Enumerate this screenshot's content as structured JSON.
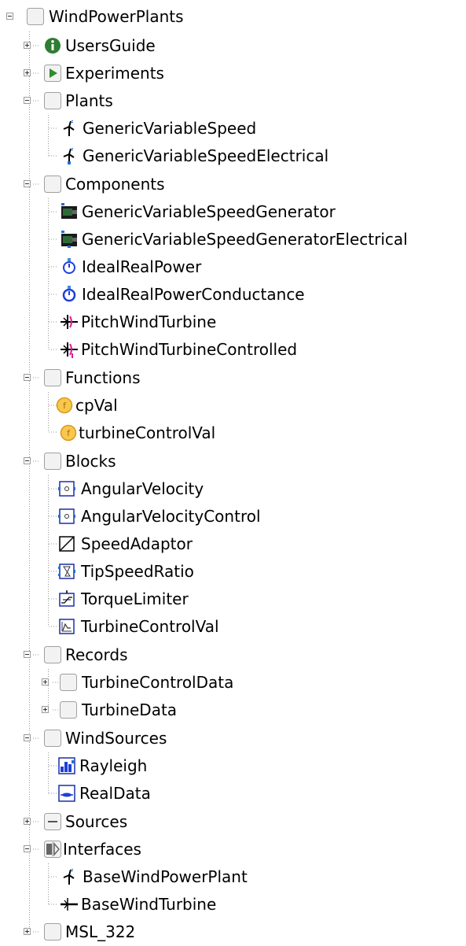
{
  "tree": {
    "root": {
      "label": "WindPowerPlants",
      "icon": "package-icon",
      "state": "expanded"
    },
    "users_guide": {
      "label": "UsersGuide",
      "icon": "info-icon",
      "state": "collapsed"
    },
    "experiments": {
      "label": "Experiments",
      "icon": "play-icon",
      "state": "collapsed"
    },
    "plants": {
      "label": "Plants",
      "icon": "package-icon",
      "state": "expanded",
      "items": [
        {
          "label": "GenericVariableSpeed",
          "icon": "wind-plant-icon"
        },
        {
          "label": "GenericVariableSpeedElectrical",
          "icon": "wind-plant-icon"
        }
      ]
    },
    "components": {
      "label": "Components",
      "icon": "package-icon",
      "state": "expanded",
      "items": [
        {
          "label": "GenericVariableSpeedGenerator",
          "icon": "generator-icon"
        },
        {
          "label": "GenericVariableSpeedGeneratorElectrical",
          "icon": "generator-icon"
        },
        {
          "label": "IdealRealPower",
          "icon": "power-meter-icon"
        },
        {
          "label": "IdealRealPowerConductance",
          "icon": "power-meter-icon"
        },
        {
          "label": "PitchWindTurbine",
          "icon": "wind-turbine-icon"
        },
        {
          "label": "PitchWindTurbineControlled",
          "icon": "wind-turbine-icon"
        }
      ]
    },
    "functions": {
      "label": "Functions",
      "icon": "package-icon",
      "state": "expanded",
      "items": [
        {
          "label": "cpVal",
          "icon": "function-icon"
        },
        {
          "label": "turbineControlVal",
          "icon": "function-icon"
        }
      ]
    },
    "blocks": {
      "label": "Blocks",
      "icon": "package-icon",
      "state": "expanded",
      "items": [
        {
          "label": "AngularVelocity",
          "icon": "block-circle-icon"
        },
        {
          "label": "AngularVelocityControl",
          "icon": "block-circle-icon"
        },
        {
          "label": "SpeedAdaptor",
          "icon": "block-diagonal-icon"
        },
        {
          "label": "TipSpeedRatio",
          "icon": "block-hourglass-icon"
        },
        {
          "label": "TorqueLimiter",
          "icon": "block-limiter-icon"
        },
        {
          "label": "TurbineControlVal",
          "icon": "block-graph-icon"
        }
      ]
    },
    "records": {
      "label": "Records",
      "icon": "package-icon",
      "state": "expanded",
      "items": [
        {
          "label": "TurbineControlData",
          "icon": "package-icon",
          "state": "collapsed"
        },
        {
          "label": "TurbineData",
          "icon": "package-icon",
          "state": "collapsed"
        }
      ]
    },
    "wind_sources": {
      "label": "WindSources",
      "icon": "package-icon",
      "state": "expanded",
      "items": [
        {
          "label": "Rayleigh",
          "icon": "rayleigh-source-icon"
        },
        {
          "label": "RealData",
          "icon": "real-data-source-icon"
        }
      ]
    },
    "sources": {
      "label": "Sources",
      "icon": "sources-package-icon",
      "state": "collapsed"
    },
    "interfaces": {
      "label": "Interfaces",
      "icon": "interfaces-package-icon",
      "state": "expanded",
      "items": [
        {
          "label": "BaseWindPowerPlant",
          "icon": "wind-plant-icon"
        },
        {
          "label": "BaseWindTurbine",
          "icon": "base-turbine-icon"
        }
      ]
    },
    "msl": {
      "label": "MSL_322",
      "icon": "package-icon",
      "state": "collapsed"
    }
  }
}
